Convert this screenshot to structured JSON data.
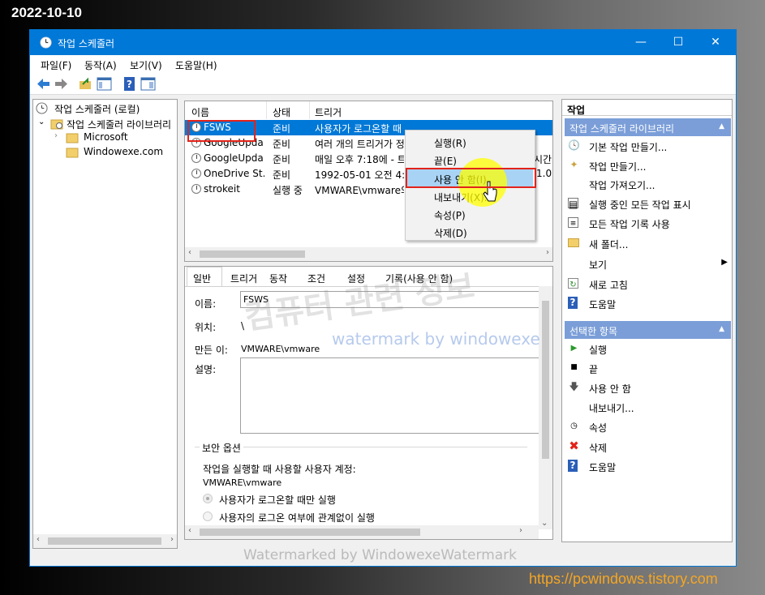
{
  "overlay": {
    "date": "2022-10-10",
    "site_url": "https://pcwindows.tistory.com",
    "watermark_ko": "컴퓨터 관련 정보",
    "watermark_en": "watermark by windowexe",
    "watermark_bottom": "Watermarked by WindowexeWatermark"
  },
  "window": {
    "title": "작업 스케줄러",
    "buttons": {
      "minimize": "—",
      "maximize": "☐",
      "close": "✕"
    }
  },
  "menu": {
    "file": "파일(F)",
    "action": "동작(A)",
    "view": "보기(V)",
    "help": "도움말(H)"
  },
  "tree": {
    "root": "작업 스케줄러 (로컬)",
    "library": "작업 스케줄러 라이브러리",
    "folders": [
      "Microsoft",
      "Windowexe.com"
    ]
  },
  "task_list": {
    "columns": [
      "이름",
      "상태",
      "트리거"
    ],
    "rows": [
      {
        "name": "FSWS",
        "status": "준비",
        "trigger": "사용자가 로그온할 때"
      },
      {
        "name": "GoogleUpda...",
        "status": "준비",
        "trigger": "여러 개의 트리거가 정"
      },
      {
        "name": "GoogleUpda...",
        "status": "준비",
        "trigger": "매일 오후 7:18에 - 트"
      },
      {
        "name": "OneDrive St...",
        "status": "준비",
        "trigger": "1992-05-01 오전 4:0"
      },
      {
        "name": "strokeit",
        "status": "실행 중",
        "trigger": "VMWARE\\vmware의"
      }
    ],
    "extra_right": [
      "시간",
      "1.0"
    ]
  },
  "context_menu": {
    "items": [
      "실행(R)",
      "끝(E)",
      "사용 안 함(I)",
      "내보내기(X)...",
      "속성(P)",
      "삭제(D)"
    ],
    "highlighted_index": 2
  },
  "details": {
    "tabs": [
      "일반",
      "트리거",
      "동작",
      "조건",
      "설정",
      "기록(사용 안 함)"
    ],
    "name_label": "이름:",
    "name_value": "FSWS",
    "location_label": "위치:",
    "location_value": "\\",
    "author_label": "만든 이:",
    "author_value": "VMWARE\\vmware",
    "description_label": "설명:",
    "security_title": "보안 옵션",
    "account_prompt": "작업을 실행할 때 사용할 사용자 계정:",
    "account_value": "VMWARE\\vmware",
    "radio_1": "사용자가 로그온할 때만 실행",
    "radio_2": "사용자의 로그온 여부에 관계없이 실행"
  },
  "actions": {
    "title": "작업",
    "section1": "작업 스케줄러 라이브러리",
    "section1_items": [
      {
        "icon": "basic-task-icon",
        "label": "기본 작업 만들기..."
      },
      {
        "icon": "create-task-icon",
        "label": "작업 만들기..."
      },
      {
        "icon": "",
        "label": "작업 가져오기..."
      },
      {
        "icon": "running-tasks-icon",
        "label": "실행 중인 모든 작업 표시"
      },
      {
        "icon": "history-icon",
        "label": "모든 작업 기록 사용"
      },
      {
        "icon": "folder-icon",
        "label": "새 폴더..."
      },
      {
        "icon": "",
        "label": "보기"
      },
      {
        "icon": "refresh-icon",
        "label": "새로 고침"
      },
      {
        "icon": "help-icon",
        "label": "도움말"
      }
    ],
    "section2": "선택한 항목",
    "section2_items": [
      {
        "icon": "run-icon",
        "label": "실행"
      },
      {
        "icon": "stop-icon",
        "label": "끝"
      },
      {
        "icon": "disable-icon",
        "label": "사용 안 함"
      },
      {
        "icon": "",
        "label": "내보내기..."
      },
      {
        "icon": "properties-icon",
        "label": "속성"
      },
      {
        "icon": "delete-icon",
        "label": "삭제"
      },
      {
        "icon": "help-icon",
        "label": "도움말"
      }
    ]
  },
  "colors": {
    "title_blue": "#0078d7",
    "action_header": "#7b9ed8",
    "highlight_red": "#e2231a",
    "context_highlight": "#a9d3f5"
  }
}
